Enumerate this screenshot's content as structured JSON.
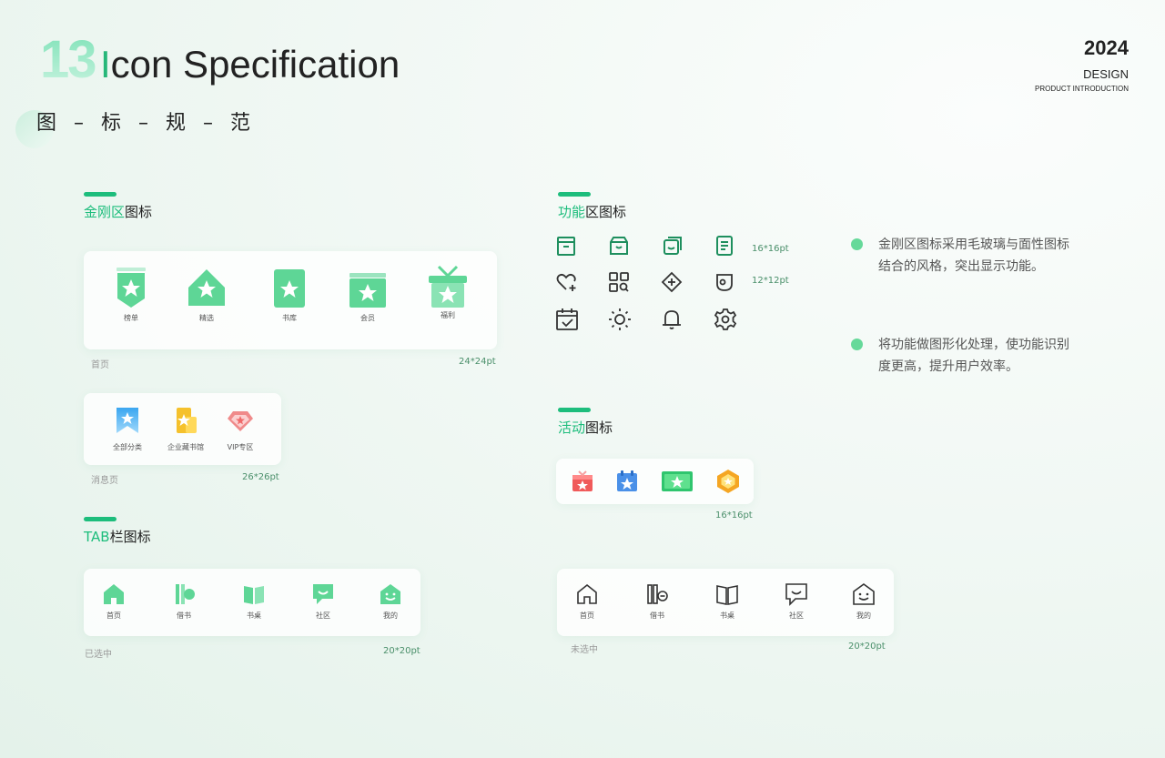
{
  "header": {
    "number": "13",
    "title_first": "I",
    "title_rest": "con Specification",
    "subtitle": "图 – 标 – 规 – 范",
    "year": "2024",
    "design": "DESIGN",
    "product": "PRODUCT INTRODUCTION"
  },
  "jingang": {
    "title_hl": "金刚区",
    "title_rest": "图标",
    "items": [
      "榜单",
      "精选",
      "书库",
      "会员",
      "福利"
    ],
    "caption": "首页",
    "size": "24*24pt"
  },
  "message": {
    "items": [
      "全部分类",
      "企业藏书馆",
      "VIP专区"
    ],
    "caption": "消息页",
    "size": "26*26pt"
  },
  "tab": {
    "title_hl": "TAB",
    "title_rest": "栏图标",
    "items": [
      "首页",
      "借书",
      "书桌",
      "社区",
      "我的"
    ],
    "caption": "已选中",
    "size": "20*20pt"
  },
  "tab_unselected": {
    "items": [
      "首页",
      "借书",
      "书桌",
      "社区",
      "我的"
    ],
    "caption": "未选中",
    "size": "20*20pt"
  },
  "function": {
    "title_hl": "功能",
    "title_rest": "区图标",
    "size_1": "16*16pt",
    "size_2": "12*12pt",
    "icons": [
      "book-icon",
      "store-icon",
      "copy-face-icon",
      "document-icon",
      "heart-plus-icon",
      "grid-search-icon",
      "diamond-plus-icon",
      "face-badge-icon",
      "calendar-check-icon",
      "sun-icon",
      "bell-icon",
      "gear-icon"
    ]
  },
  "activity": {
    "title_hl": "活动",
    "title_rest": "图标",
    "size": "16*16pt"
  },
  "notes": [
    "金刚区图标采用毛玻璃与面性图标结合的风格，突出显示功能。",
    "将功能做图形化处理，使功能识别度更高，提升用户效率。"
  ],
  "colors": {
    "accent": "#1dbd7c",
    "icon_green": "#5ed696",
    "line_icon": "#333333"
  }
}
